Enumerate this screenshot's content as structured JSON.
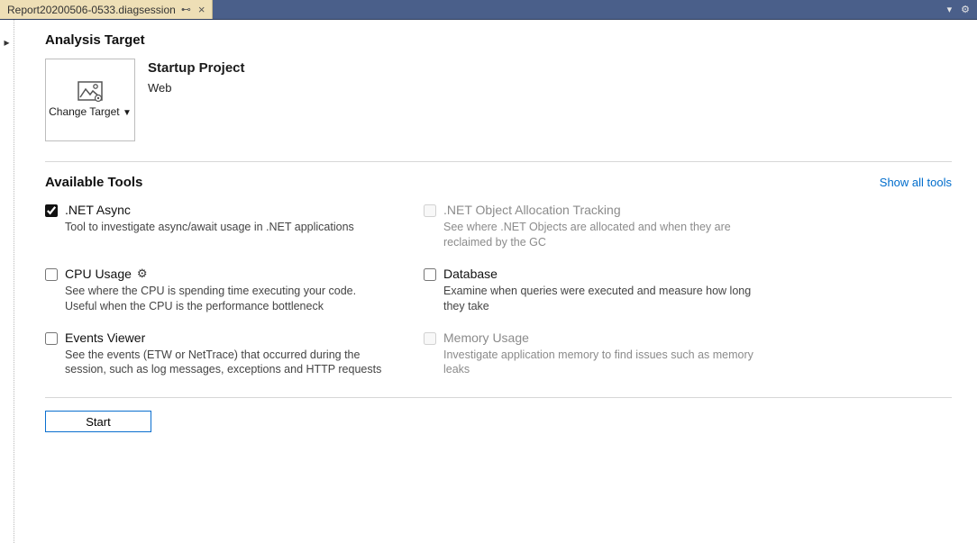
{
  "tab": {
    "title": "Report20200506-0533.diagsession"
  },
  "analysis_target": {
    "section_title": "Analysis Target",
    "change_target_label": "Change Target",
    "project_title": "Startup Project",
    "project_sub": "Web"
  },
  "available_tools": {
    "section_title": "Available Tools",
    "show_all_label": "Show all tools",
    "tools": [
      {
        "id": "net-async",
        "name": ".NET Async",
        "desc": "Tool to investigate async/await usage in .NET applications",
        "checked": true,
        "enabled": true,
        "gear": false
      },
      {
        "id": "net-alloc",
        "name": ".NET Object Allocation Tracking",
        "desc": "See where .NET Objects are allocated and when they are reclaimed by the GC",
        "checked": false,
        "enabled": false,
        "gear": false
      },
      {
        "id": "cpu-usage",
        "name": "CPU Usage",
        "desc": "See where the CPU is spending time executing your code. Useful when the CPU is the performance bottleneck",
        "checked": false,
        "enabled": true,
        "gear": true
      },
      {
        "id": "database",
        "name": "Database",
        "desc": "Examine when queries were executed and measure how long they take",
        "checked": false,
        "enabled": true,
        "gear": false
      },
      {
        "id": "events-viewer",
        "name": "Events Viewer",
        "desc": "See the events (ETW or NetTrace) that occurred during the session, such as log messages, exceptions and HTTP requests",
        "checked": false,
        "enabled": true,
        "gear": false
      },
      {
        "id": "memory-usage",
        "name": "Memory Usage",
        "desc": "Investigate application memory to find issues such as memory leaks",
        "checked": false,
        "enabled": false,
        "gear": false
      }
    ]
  },
  "start_button_label": "Start"
}
